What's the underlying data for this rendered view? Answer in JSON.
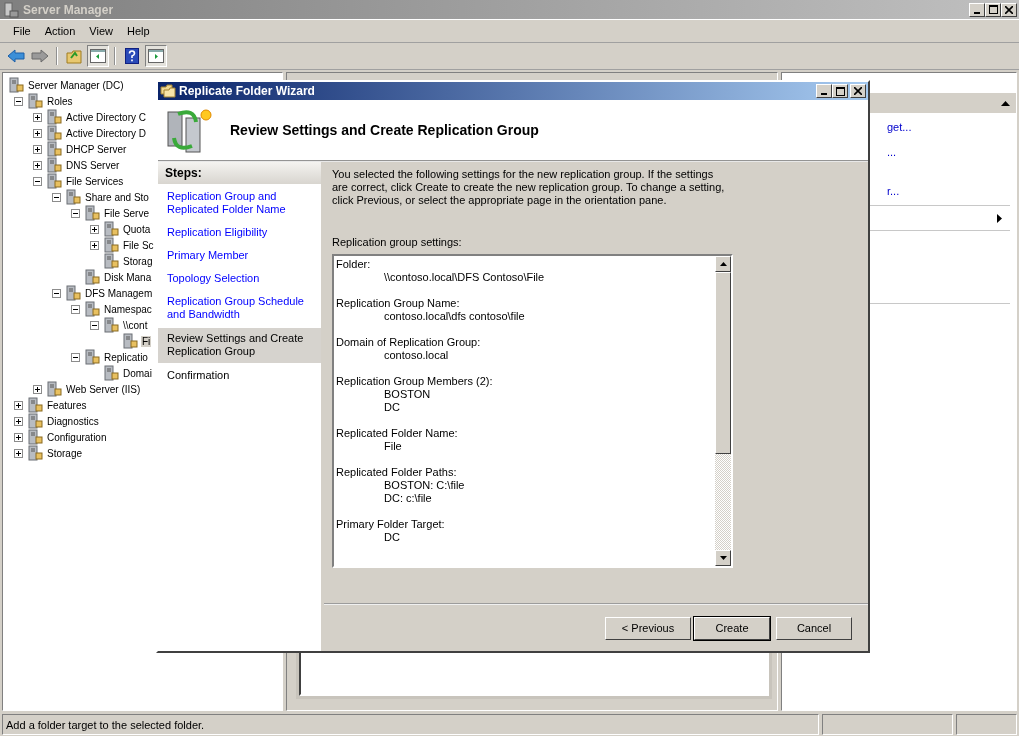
{
  "window": {
    "title": "Server Manager"
  },
  "menu": [
    "File",
    "Action",
    "View",
    "Help"
  ],
  "tree": {
    "label": "Server Manager (DC)",
    "selected": false,
    "children": [
      {
        "label": "Roles",
        "expanded": true,
        "selected": false,
        "children": [
          {
            "label": "Active Directory C",
            "expanded": false,
            "selected": false
          },
          {
            "label": "Active Directory D",
            "expanded": false,
            "selected": false
          },
          {
            "label": "DHCP Server",
            "expanded": false,
            "selected": false
          },
          {
            "label": "DNS Server",
            "expanded": false,
            "selected": false
          },
          {
            "label": "File Services",
            "expanded": true,
            "selected": false,
            "children": [
              {
                "label": "Share and Sto",
                "expanded": true,
                "selected": false,
                "children": [
                  {
                    "label": "File Serve",
                    "expanded": true,
                    "selected": false,
                    "children": [
                      {
                        "label": "Quota",
                        "expanded": false,
                        "selected": false
                      },
                      {
                        "label": "File Sc",
                        "expanded": false,
                        "selected": false
                      },
                      {
                        "label": "Storag",
                        "selected": false
                      }
                    ]
                  },
                  {
                    "label": "Disk Mana",
                    "selected": false
                  }
                ]
              },
              {
                "label": "DFS Managem",
                "expanded": true,
                "selected": false,
                "children": [
                  {
                    "label": "Namespac",
                    "expanded": true,
                    "selected": false,
                    "children": [
                      {
                        "label": "\\\\cont",
                        "expanded": true,
                        "selected": false,
                        "children": [
                          {
                            "label": "Fi",
                            "selected": true
                          }
                        ]
                      }
                    ]
                  },
                  {
                    "label": "Replicatio",
                    "expanded": true,
                    "selected": false,
                    "children": [
                      {
                        "label": "Domai",
                        "selected": false
                      }
                    ]
                  }
                ]
              }
            ]
          },
          {
            "label": "Web Server (IIS)",
            "expanded": false,
            "selected": false
          }
        ]
      },
      {
        "label": "Features",
        "expanded": false,
        "selected": false
      },
      {
        "label": "Diagnostics",
        "expanded": false,
        "selected": false
      },
      {
        "label": "Configuration",
        "expanded": false,
        "selected": false
      },
      {
        "label": "Storage",
        "expanded": false,
        "selected": false
      }
    ]
  },
  "actions": [
    "get...",
    "...",
    "r..."
  ],
  "wizard": {
    "title": "Replicate Folder Wizard",
    "heading": "Review Settings and Create Replication Group",
    "steps_title": "Steps:",
    "steps": [
      {
        "label": "Replication Group and Replicated Folder Name",
        "selected": false,
        "disabled": false
      },
      {
        "label": "Replication Eligibility",
        "selected": false,
        "disabled": false
      },
      {
        "label": "Primary Member",
        "selected": false,
        "disabled": false
      },
      {
        "label": "Topology Selection",
        "selected": false,
        "disabled": false
      },
      {
        "label": "Replication Group Schedule and Bandwidth",
        "selected": false,
        "disabled": false
      },
      {
        "label": "Review Settings and Create Replication Group",
        "selected": true,
        "disabled": false
      },
      {
        "label": "Confirmation",
        "selected": false,
        "disabled": true
      }
    ],
    "intro": "You selected the following settings for the new replication group. If the settings are correct, click Create to create the new replication group. To change a setting, click Previous, or select the appropriate page in the orientation pane.",
    "settings_label": "Replication group settings:",
    "settings": [
      {
        "label": "Folder:",
        "values": [
          "\\\\contoso.local\\DFS Contoso\\File"
        ]
      },
      {
        "label": "Replication Group Name:",
        "values": [
          "contoso.local\\dfs contoso\\file"
        ]
      },
      {
        "label": "Domain of Replication Group:",
        "values": [
          "contoso.local"
        ]
      },
      {
        "label": "Replication Group Members (2):",
        "values": [
          "BOSTON",
          "DC"
        ]
      },
      {
        "label": "Replicated Folder Name:",
        "values": [
          "File"
        ]
      },
      {
        "label": "Replicated Folder Paths:",
        "values": [
          "BOSTON: C:\\file",
          "DC: c:\\file"
        ]
      },
      {
        "label": "Primary Folder Target:",
        "values": [
          "DC"
        ]
      }
    ],
    "buttons": [
      {
        "label": "< Previous",
        "default": false
      },
      {
        "label": "Create",
        "default": true
      },
      {
        "label": "Cancel",
        "default": false
      }
    ]
  },
  "status_bar": {
    "text": "Add a folder target to the selected folder."
  }
}
